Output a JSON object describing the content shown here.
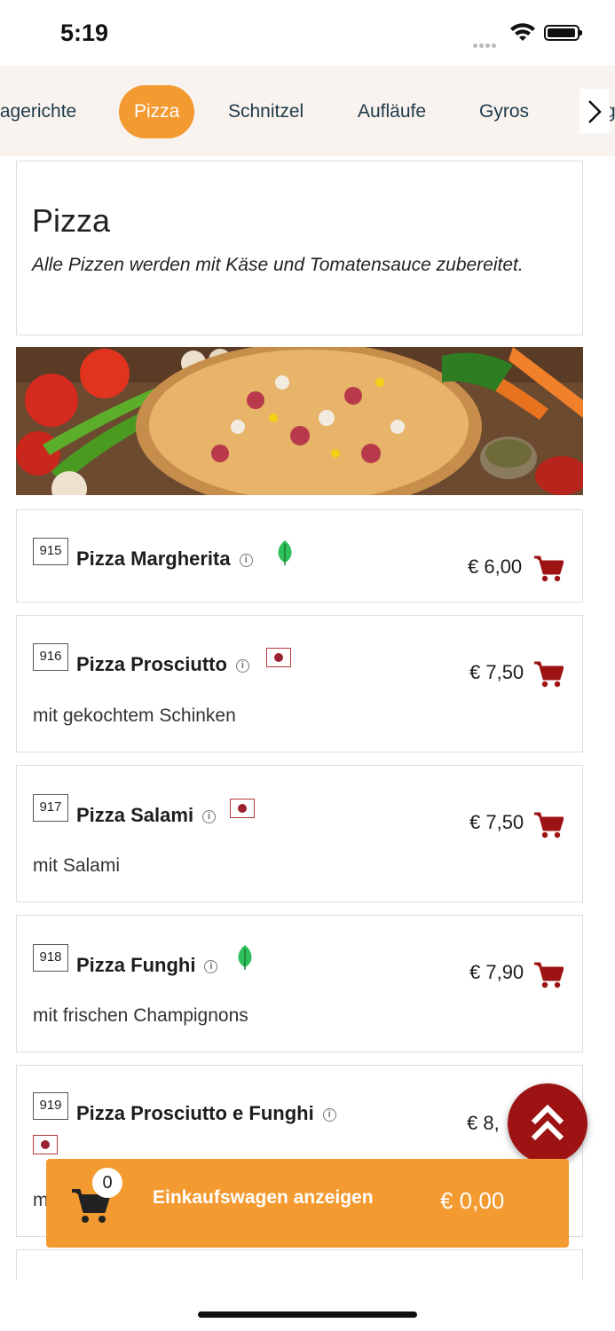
{
  "status": {
    "time": "5:19"
  },
  "categories": [
    {
      "label": "tagerichte",
      "active": false
    },
    {
      "label": "Pizza",
      "active": true
    },
    {
      "label": "Schnitzel",
      "active": false
    },
    {
      "label": "Aufläufe",
      "active": false
    },
    {
      "label": "Gyros",
      "active": false
    },
    {
      "label": "g",
      "active": false
    }
  ],
  "section": {
    "title": "Pizza",
    "description": "Alle Pizzen werden mit Käse und Tomatensauce zubereitet."
  },
  "items": [
    {
      "number": "915",
      "name": "Pizza Margherita",
      "price": "€ 6,00",
      "description": "",
      "tag": "vegetarian-leaf-icon"
    },
    {
      "number": "916",
      "name": "Pizza Prosciutto",
      "price": "€ 7,50",
      "description": "mit gekochtem Schinken",
      "tag": "meat-icon"
    },
    {
      "number": "917",
      "name": "Pizza Salami",
      "price": "€ 7,50",
      "description": "mit Salami",
      "tag": "meat-icon"
    },
    {
      "number": "918",
      "name": "Pizza Funghi",
      "price": "€ 7,90",
      "description": "mit frischen Champignons",
      "tag": "vegetarian-leaf-icon"
    },
    {
      "number": "919",
      "name": "Pizza Prosciutto e Funghi",
      "price": "€ 8,",
      "description": "m",
      "tag": "meat-icon"
    }
  ],
  "info_glyph": "i",
  "cart": {
    "count": "0",
    "label": "Einkaufswagen anzeigen",
    "total": "€ 0,00"
  },
  "colors": {
    "accent": "#f39a30",
    "cart_icon": "#9d1313",
    "leaf": "#2fbf5a",
    "meat": "#9b2230"
  }
}
